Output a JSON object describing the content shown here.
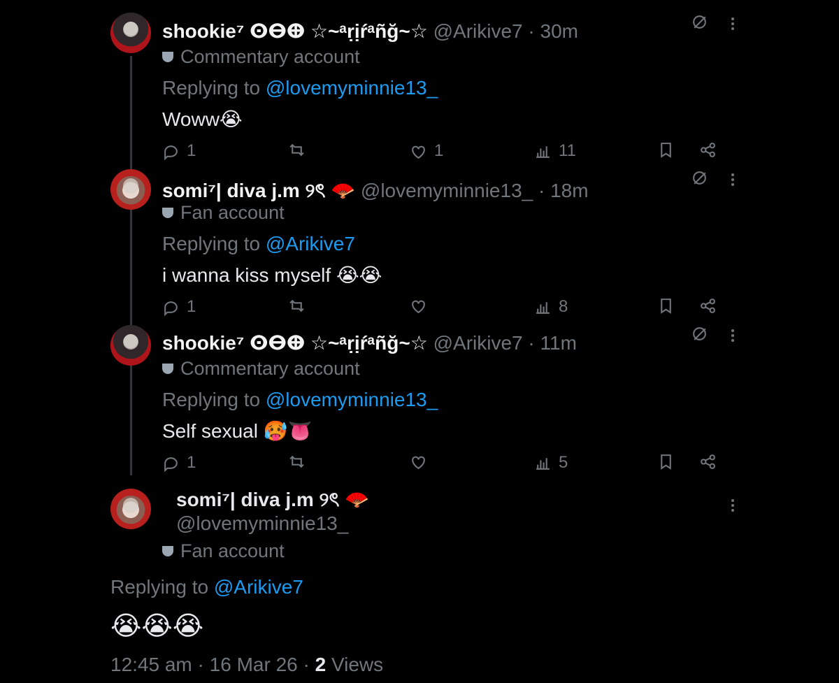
{
  "thread": [
    {
      "name": "shookie⁷ ⵙⴱⴲ ☆~ᵃṛịŕᵃñğ~☆",
      "handle": "@Arikive7",
      "separator": "·",
      "time": "30m",
      "account_label": "Commentary account",
      "replying_label": "Replying to ",
      "replying_to": "@lovemyminnie13_",
      "text": "Woww😭",
      "replies": "1",
      "reposts": "",
      "likes": "1",
      "views": "11"
    },
    {
      "name": "somi⁷| diva j.m ୨ৎ 🪭",
      "handle": "@lovemyminnie13_",
      "separator": "·",
      "time": "18m",
      "account_label": "Fan account",
      "replying_label": "Replying to ",
      "replying_to": "@Arikive7",
      "text": "i wanna kiss myself 😭😭",
      "replies": "1",
      "reposts": "",
      "likes": "",
      "views": "8"
    },
    {
      "name": "shookie⁷ ⵙⴱⴲ ☆~ᵃṛịŕᵃñğ~☆",
      "handle": "@Arikive7",
      "separator": "·",
      "time": "11m",
      "account_label": "Commentary account",
      "replying_label": "Replying to ",
      "replying_to": "@lovemyminnie13_",
      "text": "Self sexual 🥵👅",
      "replies": "1",
      "reposts": "",
      "likes": "",
      "views": "5"
    }
  ],
  "main": {
    "name": "somi⁷| diva j.m ୨ৎ 🪭",
    "handle": "@lovemyminnie13_",
    "account_label": "Fan account",
    "replying_label": "Replying to ",
    "replying_to": "@Arikive7",
    "text": "😭😭😭",
    "time": "12:45 am",
    "dot": "·",
    "date": "16 Mar 26",
    "views_count": "2",
    "views_label": "Views"
  }
}
